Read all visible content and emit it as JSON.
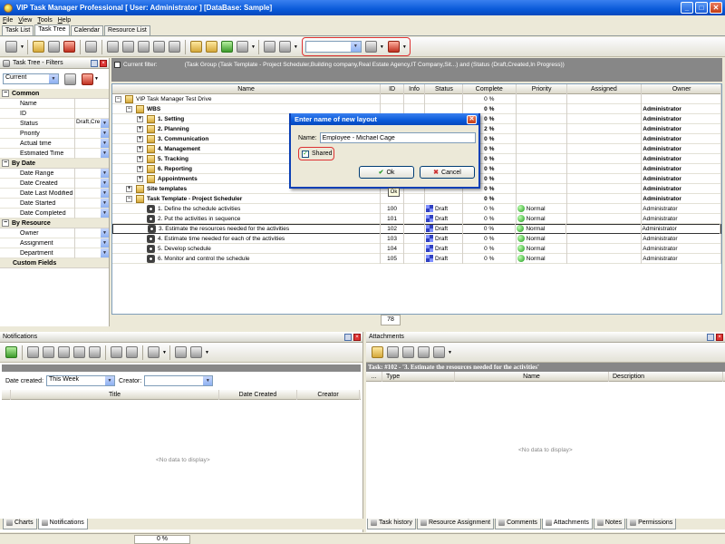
{
  "app": {
    "title": "VIP Task Manager Professional [ User: Administrator ] [DataBase: Sample]"
  },
  "menu": [
    "File",
    "View",
    "Tools",
    "Help"
  ],
  "view_tabs": [
    "Task List",
    "Task Tree",
    "Calendar",
    "Resource List"
  ],
  "active_view_tab": "Task Tree",
  "left_panel": {
    "title": "Task Tree - Filters",
    "filter_combo": "Current",
    "categories": [
      {
        "label": "Common",
        "props": [
          {
            "name": "Name",
            "value": "",
            "dropdown": false
          },
          {
            "name": "ID",
            "value": "",
            "dropdown": false
          },
          {
            "name": "Status",
            "value": "Draft,Cre",
            "dropdown": true
          },
          {
            "name": "Priority",
            "value": "",
            "dropdown": true
          },
          {
            "name": "Actual time",
            "value": "",
            "dropdown": true
          },
          {
            "name": "Estimated Time",
            "value": "",
            "dropdown": true
          }
        ]
      },
      {
        "label": "By Date",
        "props": [
          {
            "name": "Date Range",
            "value": "",
            "dropdown": true
          },
          {
            "name": "Date Created",
            "value": "",
            "dropdown": true
          },
          {
            "name": "Date Last Modified",
            "value": "",
            "dropdown": true
          },
          {
            "name": "Date Started",
            "value": "",
            "dropdown": true
          },
          {
            "name": "Date Completed",
            "value": "",
            "dropdown": true
          }
        ]
      },
      {
        "label": "By Resource",
        "props": [
          {
            "name": "Owner",
            "value": "",
            "dropdown": true
          },
          {
            "name": "Assignment",
            "value": "",
            "dropdown": true
          },
          {
            "name": "Department",
            "value": "",
            "dropdown": true
          }
        ]
      },
      {
        "label": "Custom Fields",
        "props": []
      }
    ]
  },
  "current_filter": {
    "label": "Current filter:",
    "text": "(Task Group (Task Template - Project Scheduler,Building company,Real Estate Agency,IT Company,Sit...) and (Status (Draft,Created,In Progress))"
  },
  "grid": {
    "columns": [
      "Name",
      "ID",
      "Info",
      "Status",
      "Complete",
      "Priority",
      "Assigned",
      "Owner"
    ],
    "rows": [
      {
        "name": "VIP Task Manager Test Drive",
        "level": 0,
        "exp": "−",
        "icon": "folder",
        "bold": false,
        "id": "",
        "status": "",
        "complete": "0 %",
        "priority": "",
        "owner": ""
      },
      {
        "name": "WBS",
        "level": 1,
        "exp": "−",
        "icon": "folder",
        "bold": true,
        "id": "",
        "status": "",
        "complete": "0 %",
        "priority": "",
        "owner": "Administrator"
      },
      {
        "name": "1. Setting",
        "level": 2,
        "exp": "+",
        "icon": "folder",
        "bold": true,
        "id": "",
        "status": "",
        "complete": "0 %",
        "priority": "",
        "owner": "Administrator"
      },
      {
        "name": "2. Planning",
        "level": 2,
        "exp": "+",
        "icon": "folder",
        "bold": true,
        "id": "",
        "status": "",
        "complete": "2 %",
        "priority": "",
        "owner": "Administrator"
      },
      {
        "name": "3. Communication",
        "level": 2,
        "exp": "+",
        "icon": "folder",
        "bold": true,
        "id": "",
        "status": "",
        "complete": "0 %",
        "priority": "",
        "owner": "Administrator"
      },
      {
        "name": "4. Management",
        "level": 2,
        "exp": "+",
        "icon": "folder",
        "bold": true,
        "id": "",
        "status": "",
        "complete": "0 %",
        "priority": "",
        "owner": "Administrator"
      },
      {
        "name": "5. Tracking",
        "level": 2,
        "exp": "+",
        "icon": "folder",
        "bold": true,
        "id": "",
        "status": "",
        "complete": "0 %",
        "priority": "",
        "owner": "Administrator"
      },
      {
        "name": "6. Reporting",
        "level": 2,
        "exp": "+",
        "icon": "folder",
        "bold": true,
        "id": "",
        "status": "",
        "complete": "0 %",
        "priority": "",
        "owner": "Administrator"
      },
      {
        "name": "Appointments",
        "level": 2,
        "exp": "+",
        "icon": "folder",
        "bold": true,
        "id": "",
        "status": "",
        "complete": "0 %",
        "priority": "",
        "owner": "Administrator"
      },
      {
        "name": "Site templates",
        "level": 1,
        "exp": "+",
        "icon": "folder",
        "bold": true,
        "id": "",
        "status": "",
        "complete": "0 %",
        "priority": "",
        "owner": "Administrator"
      },
      {
        "name": "Task Template - Project Scheduler",
        "level": 1,
        "exp": "−",
        "icon": "folder",
        "bold": true,
        "id": "",
        "status": "",
        "complete": "0 %",
        "priority": "",
        "owner": "Administrator"
      },
      {
        "name": "1. Define the schedule activities",
        "level": 2,
        "exp": "",
        "icon": "task",
        "bold": false,
        "id": "100",
        "status": "Draft",
        "complete": "0 %",
        "priority": "Normal",
        "owner": "Administrator"
      },
      {
        "name": "2. Put the activities in sequence",
        "level": 2,
        "exp": "",
        "icon": "task",
        "bold": false,
        "id": "101",
        "status": "Draft",
        "complete": "0 %",
        "priority": "Normal",
        "owner": "Administrator"
      },
      {
        "name": "3. Estimate the resources needed for the activities",
        "level": 2,
        "exp": "",
        "icon": "task",
        "bold": false,
        "id": "102",
        "status": "Draft",
        "complete": "0 %",
        "priority": "Normal",
        "owner": "Administrator",
        "selected": true
      },
      {
        "name": "4. Estimate time needed for each of the activities",
        "level": 2,
        "exp": "",
        "icon": "task",
        "bold": false,
        "id": "103",
        "status": "Draft",
        "complete": "0 %",
        "priority": "Normal",
        "owner": "Administrator"
      },
      {
        "name": "5. Develop schedule",
        "level": 2,
        "exp": "",
        "icon": "task",
        "bold": false,
        "id": "104",
        "status": "Draft",
        "complete": "0 %",
        "priority": "Normal",
        "owner": "Administrator"
      },
      {
        "name": "6. Monitor and control the schedule",
        "level": 2,
        "exp": "",
        "icon": "task",
        "bold": false,
        "id": "105",
        "status": "Draft",
        "complete": "0 %",
        "priority": "Normal",
        "owner": "Administrator"
      }
    ],
    "row_count": "78"
  },
  "dialog": {
    "title": "Enter name of new layout",
    "name_label": "Name:",
    "name_value": "Employee - Michael Cage",
    "shared_label": "Shared",
    "shared_checked": true,
    "ok_label": "Ok",
    "cancel_label": "Cancel",
    "tooltip": "Ok"
  },
  "notifications": {
    "title": "Notifications",
    "date_created_label": "Date created:",
    "date_created_value": "This Week",
    "creator_label": "Creator:",
    "creator_value": "",
    "columns": [
      "Title",
      "Date Created",
      "Creator"
    ],
    "empty_text": "<No data to display>",
    "tabs": [
      "Charts",
      "Notifications"
    ],
    "active_tab": "Notifications"
  },
  "attachments": {
    "title": "Attachments",
    "task_caption": "Task: #102 - '3. Estimate the resources needed for the activities'",
    "columns": [
      "...",
      "Type",
      "Name",
      "Description"
    ],
    "empty_text": "<No data to display>",
    "tabs": [
      "Task history",
      "Resource Assignment",
      "Comments",
      "Attachments",
      "Notes",
      "Permissions"
    ],
    "active_tab": "Attachments"
  },
  "status_bar": {
    "progress": "0 %"
  },
  "colors": {
    "title_blue": "#0a5ad9",
    "highlight_red": "#d33333",
    "filter_bar": "#878787"
  }
}
